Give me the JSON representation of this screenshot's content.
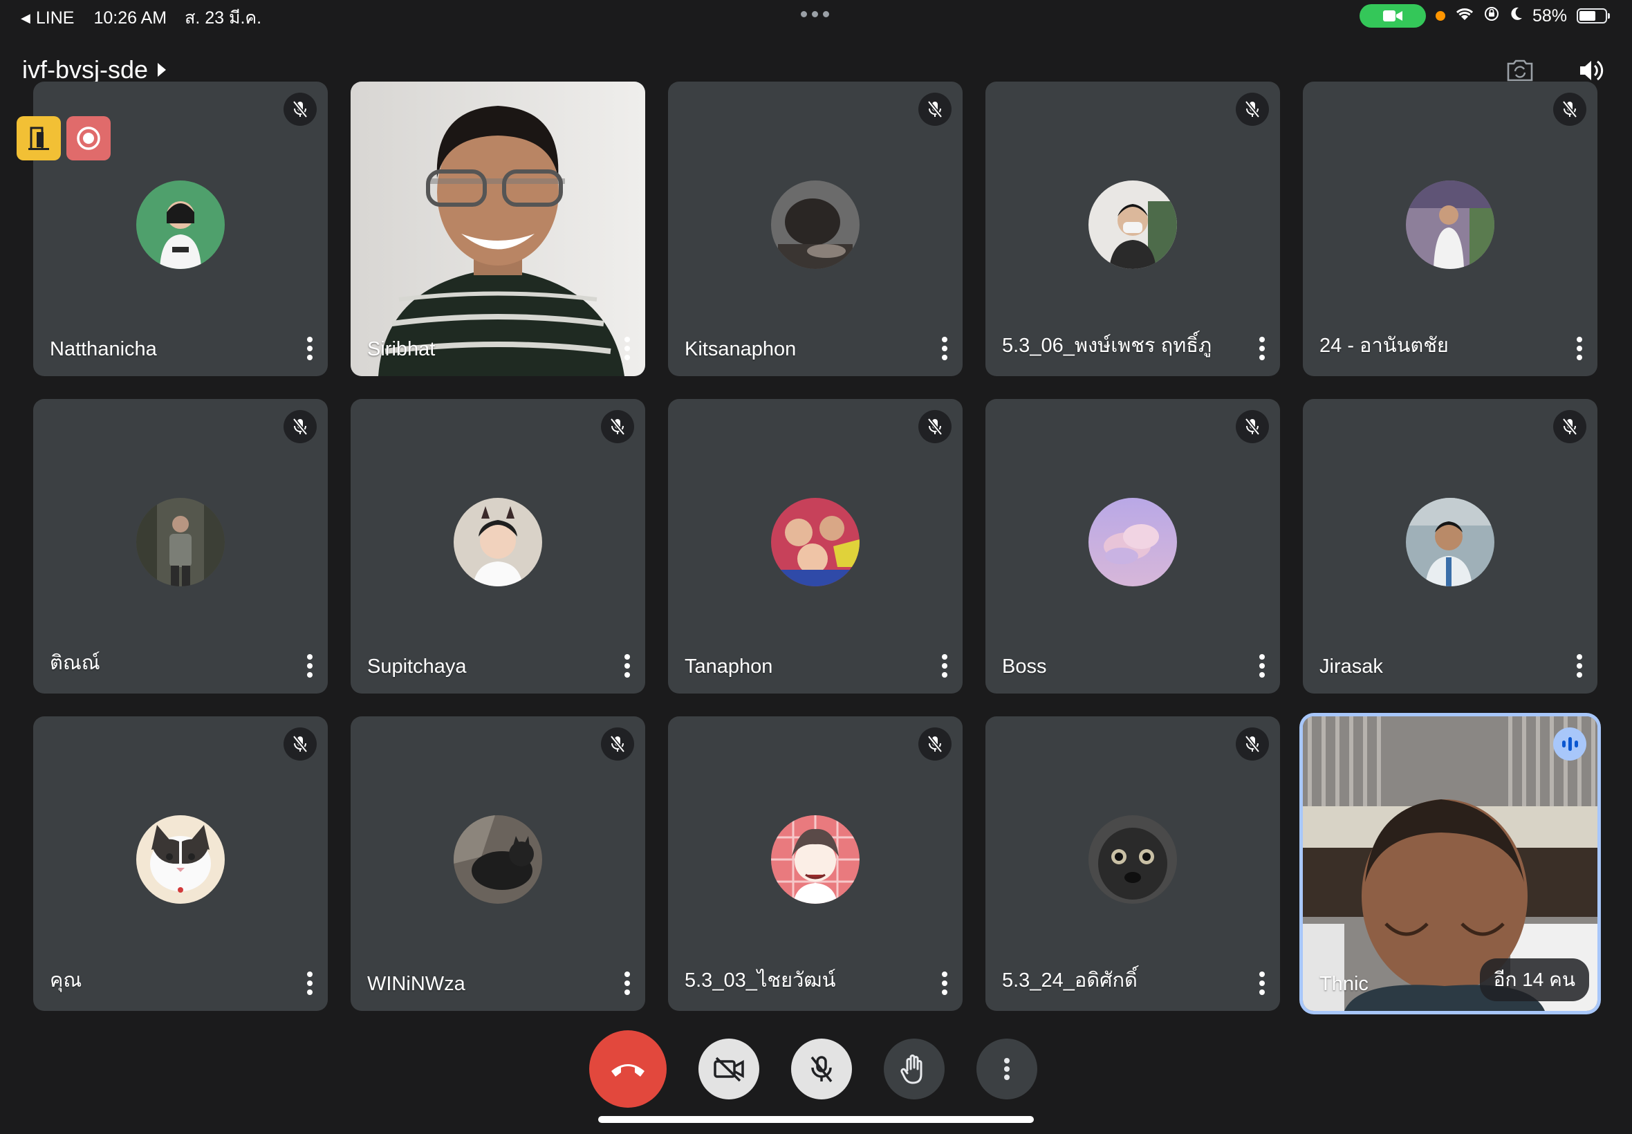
{
  "status_bar": {
    "back_app": "LINE",
    "time": "10:26 AM",
    "date": "ส. 23 มี.ค.",
    "battery": "58%",
    "battery_level": 0.58,
    "accent_call": "#34c759"
  },
  "meeting": {
    "code": "ivf-bvsj-sde"
  },
  "participants": [
    {
      "name": "Natthanicha",
      "muted": true
    },
    {
      "name": "Siribhat",
      "muted": false
    },
    {
      "name": "Kitsanaphon",
      "muted": true
    },
    {
      "name": "5.3_06_พงษ์เพชร ฤทธิ์ภู",
      "muted": true
    },
    {
      "name": "24 - อานันตชัย",
      "muted": true
    },
    {
      "name": "ติณณ์",
      "muted": true
    },
    {
      "name": "Supitchaya",
      "muted": true
    },
    {
      "name": "Tanaphon",
      "muted": true
    },
    {
      "name": "Boss",
      "muted": true
    },
    {
      "name": "Jirasak",
      "muted": true
    },
    {
      "name": "คุณ",
      "muted": true
    },
    {
      "name": "WINiNWza",
      "muted": true
    },
    {
      "name": "5.3_03_ไชยวัฒน์",
      "muted": true
    },
    {
      "name": "5.3_24_อดิศักดิ์",
      "muted": true
    },
    {
      "name": "Thnic",
      "muted": false,
      "speaking": true
    }
  ],
  "overflow": {
    "label": "อีก 14 คน"
  },
  "colors": {
    "tile": "#3c4043",
    "end_call": "#e2483d",
    "active_outline": "#a8c7fa",
    "badge_warn": "#f2c035",
    "badge_rec": "#e06b6b"
  }
}
